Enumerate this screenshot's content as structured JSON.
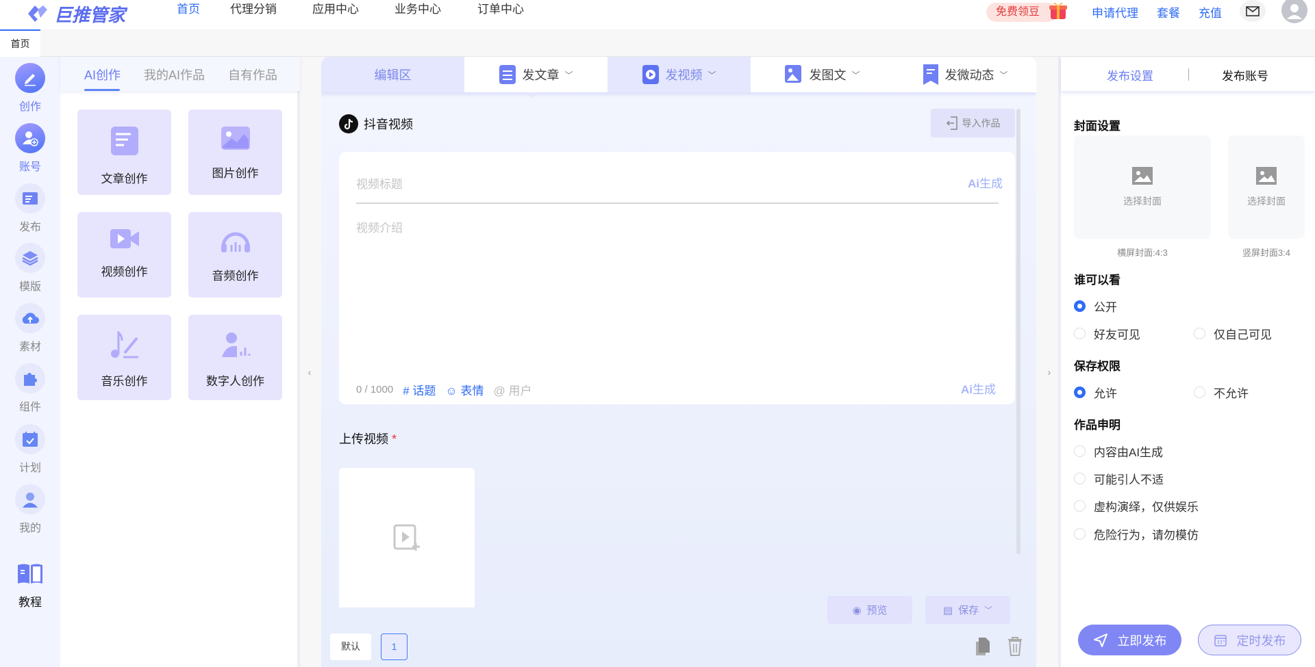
{
  "header": {
    "logo_text": "巨推管家",
    "nav": [
      "首页",
      "代理分销",
      "应用中心",
      "业务中心",
      "订单中心"
    ],
    "active_nav": 0,
    "promo": "免费领豆",
    "links": [
      "申请代理",
      "套餐",
      "充值"
    ]
  },
  "page_tabs": [
    "首页"
  ],
  "rail": [
    {
      "label": "创作",
      "icon": "pen-icon"
    },
    {
      "label": "账号",
      "icon": "user-add-icon"
    },
    {
      "label": "发布",
      "icon": "publish-icon"
    },
    {
      "label": "模版",
      "icon": "layers-icon"
    },
    {
      "label": "素材",
      "icon": "cloud-upload-icon"
    },
    {
      "label": "组件",
      "icon": "puzzle-icon"
    },
    {
      "label": "计划",
      "icon": "calendar-check-icon"
    },
    {
      "label": "我的",
      "icon": "user-icon"
    }
  ],
  "tutorial": "教程",
  "ai_panel": {
    "tabs": [
      "AI创作",
      "我的AI作品",
      "自有作品"
    ],
    "cards": [
      "文章创作",
      "图片创作",
      "视频创作",
      "音频创作",
      "音乐创作",
      "数字人创作"
    ]
  },
  "center": {
    "tabs": [
      "编辑区",
      "发文章",
      "发视频",
      "发图文",
      "发微动态"
    ],
    "platform": "抖音视频",
    "import": "导入作品",
    "title_placeholder": "视频标题",
    "intro_placeholder": "视频介绍",
    "ai_gen": "生成",
    "ai_mark": "Ai",
    "counter": "0 / 1000",
    "topic": "话题",
    "emoji": "表情",
    "user": "用户",
    "upload_label": "上传视频",
    "required": "*",
    "preview": "预览",
    "save": "保存",
    "default_tab": "默认",
    "page": "1"
  },
  "right": {
    "tabs": [
      "发布设置",
      "发布账号"
    ],
    "cover_title": "封面设置",
    "choose_cover": "选择封面",
    "cover_h": "横屏封面:4:3",
    "cover_v": "竖屏封面3:4",
    "who_title": "谁可以看",
    "who": [
      "公开",
      "好友可见",
      "仅自己可见"
    ],
    "save_title": "保存权限",
    "save_opts": [
      "允许",
      "不允许"
    ],
    "decl_title": "作品申明",
    "decl": [
      "内容由AI生成",
      "可能引人不适",
      "虚构演绎，仅供娱乐",
      "危险行为，请勿模仿"
    ],
    "publish_now": "立即发布",
    "schedule": "定时发布"
  },
  "colors": {
    "accent": "#2f6bf5",
    "purple": "#8087f5"
  }
}
